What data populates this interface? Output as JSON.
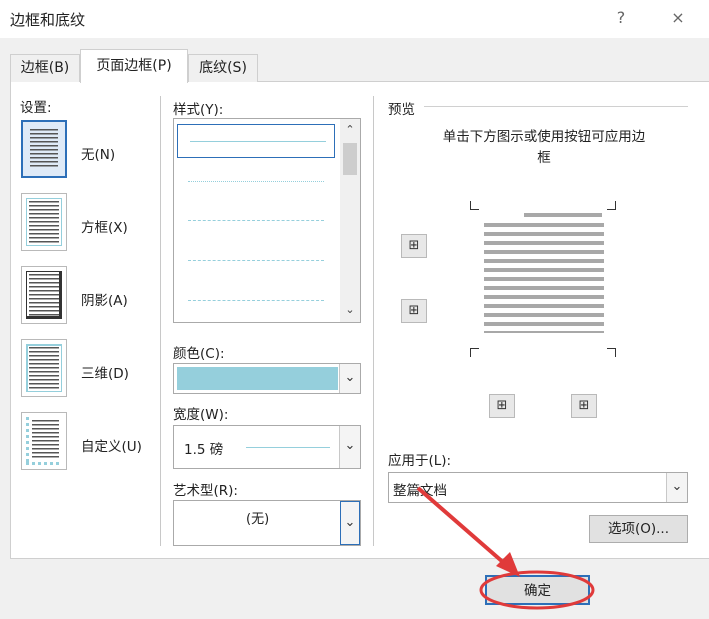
{
  "window": {
    "title": "边框和底纹",
    "help": "?",
    "close": "×"
  },
  "tabs": [
    {
      "label": "边框(B)"
    },
    {
      "label": "页面边框(P)"
    },
    {
      "label": "底纹(S)"
    }
  ],
  "settings": {
    "heading": "设置:",
    "items": [
      {
        "label": "无(N)",
        "icon": "none-border-icon"
      },
      {
        "label": "方框(X)",
        "icon": "box-border-icon"
      },
      {
        "label": "阴影(A)",
        "icon": "shadow-border-icon"
      },
      {
        "label": "三维(D)",
        "icon": "3d-border-icon"
      },
      {
        "label": "自定义(U)",
        "icon": "custom-border-icon"
      }
    ]
  },
  "style": {
    "label": "样式(Y):"
  },
  "color": {
    "label": "颜色(C):",
    "value_color": "#95cfdc"
  },
  "width": {
    "label": "宽度(W):",
    "value": "1.5 磅"
  },
  "art": {
    "label": "艺术型(R):",
    "value": "(无)"
  },
  "preview": {
    "heading": "预览",
    "instruction": "单击下方图示或使用按钮可应用边框"
  },
  "apply": {
    "label": "应用于(L):",
    "value": "整篇文档"
  },
  "buttons": {
    "options": "选项(O)...",
    "ok": "确定"
  },
  "colors": {
    "accent": "#2d6fb8",
    "highlight_arrow": "#e03a3a",
    "line_color": "#95cfdc"
  }
}
